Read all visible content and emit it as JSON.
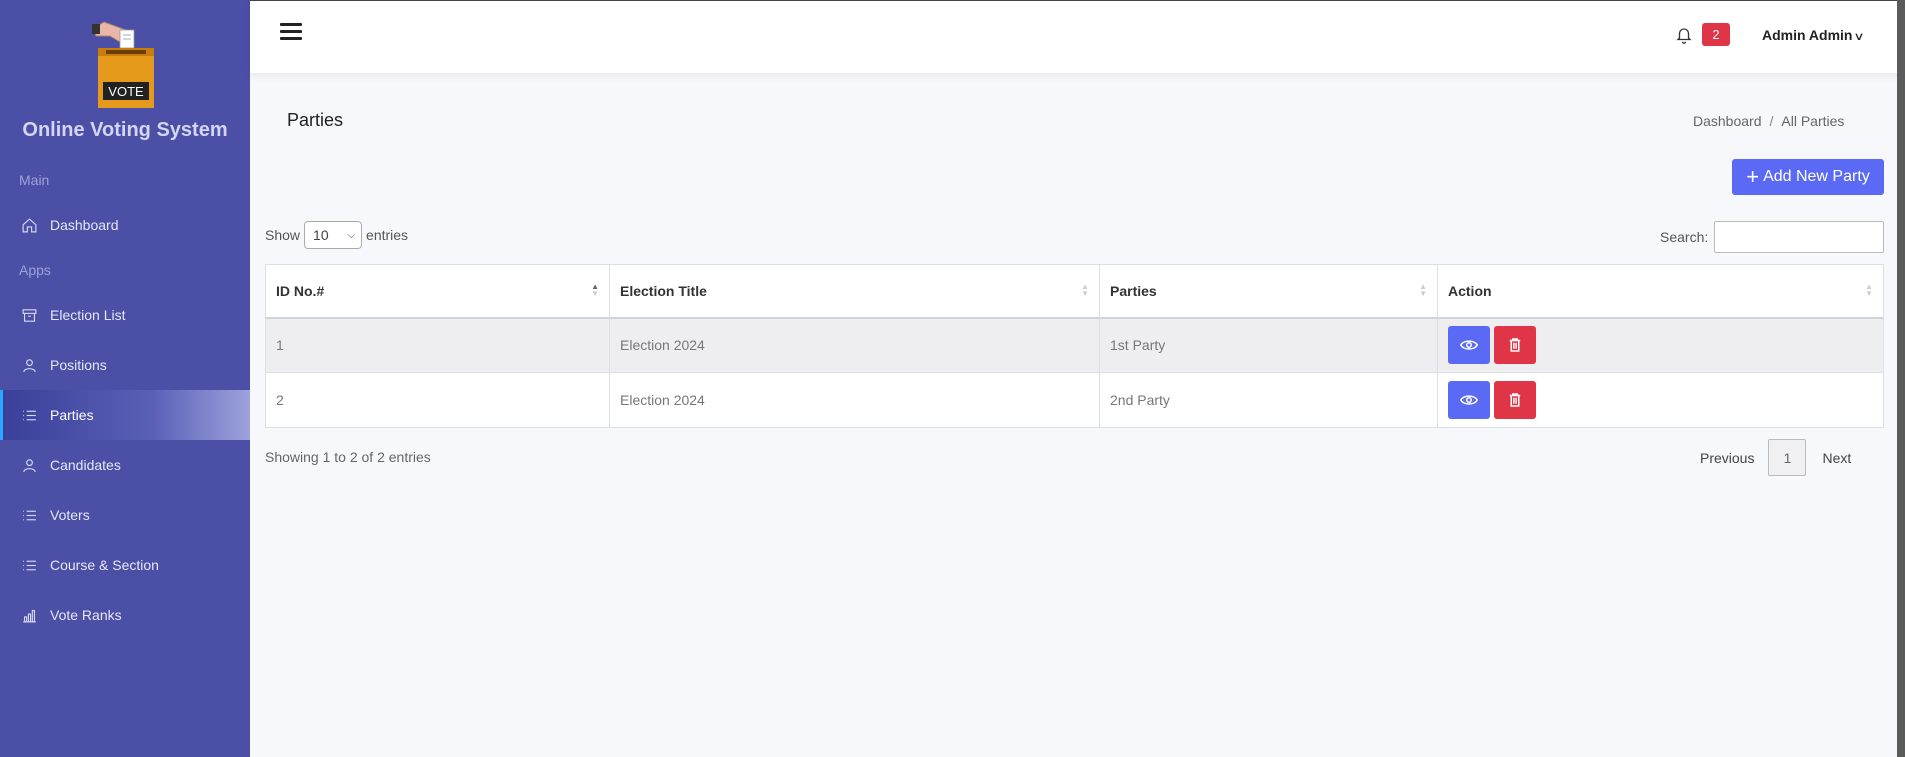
{
  "app": {
    "title": "Online Voting System",
    "logo_text": "VOTE"
  },
  "sidebar": {
    "section_main": "Main",
    "section_apps": "Apps",
    "items": [
      {
        "label": "Dashboard",
        "icon": "home-icon"
      },
      {
        "label": "Election List",
        "icon": "archive-icon"
      },
      {
        "label": "Positions",
        "icon": "user-icon"
      },
      {
        "label": "Parties",
        "icon": "list-icon",
        "active": true
      },
      {
        "label": "Candidates",
        "icon": "user-icon"
      },
      {
        "label": "Voters",
        "icon": "list-icon"
      },
      {
        "label": "Course & Section",
        "icon": "list-icon"
      },
      {
        "label": "Vote Ranks",
        "icon": "bar-chart-icon"
      }
    ]
  },
  "header": {
    "notification_count": "2",
    "user_name": "Admin Admin"
  },
  "page": {
    "title": "Parties",
    "breadcrumb": [
      "Dashboard",
      "All Parties"
    ],
    "add_button": "Add New Party"
  },
  "table_controls": {
    "show_label": "Show",
    "entries_value": "10",
    "entries_label": "entries",
    "search_label": "Search:",
    "search_value": ""
  },
  "table": {
    "columns": [
      "ID No.#",
      "Election Title",
      "Parties",
      "Action"
    ],
    "rows": [
      {
        "id": "1",
        "election": "Election 2024",
        "party": "1st Party"
      },
      {
        "id": "2",
        "election": "Election 2024",
        "party": "2nd Party"
      }
    ]
  },
  "footer": {
    "info": "Showing 1 to 2 of 2 entries",
    "previous": "Previous",
    "page": "1",
    "next": "Next"
  },
  "colors": {
    "sidebar": "#4b4fa6",
    "primary": "#5b6af5",
    "danger": "#e03546"
  }
}
